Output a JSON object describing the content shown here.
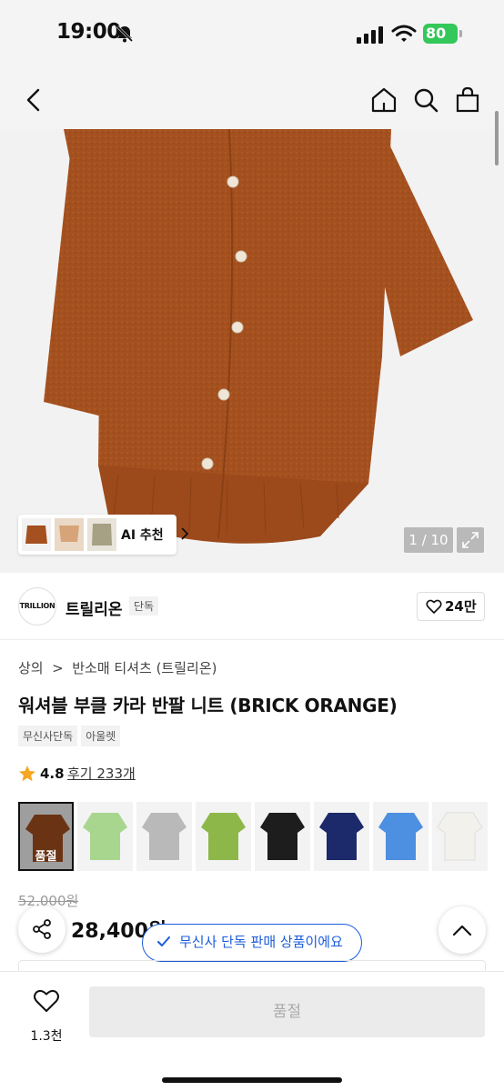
{
  "status_bar": {
    "time": "19:00",
    "battery": "80"
  },
  "nav": {
    "icons": [
      "back-icon",
      "home-icon",
      "search-icon",
      "shopping-bag-icon"
    ]
  },
  "hero": {
    "ai_recommend_label": "AI 추천",
    "image_counter": "1 / 10"
  },
  "brand": {
    "logo_text": "TRILLION",
    "name": "트릴리온",
    "badge": "단독",
    "likes": "24만"
  },
  "product": {
    "breadcrumb": "상의  >  반소매 티셔츠 (트릴리온)",
    "title": "워셔블 부클 카라 반팔 니트 (BRICK ORANGE)",
    "tags": [
      "무신사단독",
      "아울렛"
    ],
    "rating": "4.8",
    "reviews": "후기 233개",
    "colors": [
      {
        "hex": "#a4501f",
        "selected": true,
        "label": "품절"
      },
      {
        "hex": "#a8d68e",
        "selected": false,
        "label": ""
      },
      {
        "hex": "#b9b9b9",
        "selected": false,
        "label": ""
      },
      {
        "hex": "#8eb74a",
        "selected": false,
        "label": ""
      },
      {
        "hex": "#1d1d1d",
        "selected": false,
        "label": ""
      },
      {
        "hex": "#1c2a6b",
        "selected": false,
        "label": ""
      },
      {
        "hex": "#4d8fe0",
        "selected": false,
        "label": ""
      },
      {
        "hex": "#f2f1ec",
        "selected": false,
        "label": ""
      }
    ],
    "original_price": "52,000원",
    "sale_price": "28,400원",
    "exclusive_banner": "무신사 단독 판매 상품이에요"
  },
  "bottom": {
    "wish_count": "1.3천",
    "buy_label": "품절"
  },
  "colors": {
    "accent": "#1c5cdb",
    "sweater": "#a4501f",
    "star": "#f5a623"
  }
}
